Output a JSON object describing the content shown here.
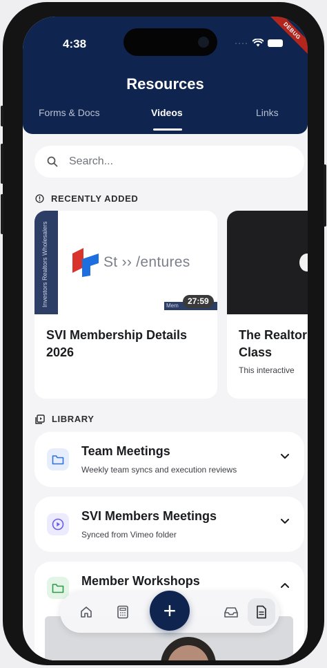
{
  "status_bar": {
    "time": "4:38",
    "debug_label": "DEBUG"
  },
  "header": {
    "title": "Resources",
    "tabs": [
      {
        "label": "Forms & Docs",
        "active": false
      },
      {
        "label": "Videos",
        "active": true
      },
      {
        "label": "Links",
        "active": false
      }
    ]
  },
  "search": {
    "placeholder": "Search..."
  },
  "recently_added": {
    "heading": "RECENTLY ADDED",
    "cards": [
      {
        "title": "SVI Membership Details 2026",
        "duration": "27:59",
        "thumb_band_text": "Investors Realtors Wholesalers",
        "thumb_logo_text": "St  ›› /entures",
        "thumb_mini_text": "Mem"
      },
      {
        "title": "The Realtor Class",
        "subtitle": "This interactive"
      }
    ]
  },
  "library": {
    "heading": "LIBRARY",
    "items": [
      {
        "title": "Team Meetings",
        "subtitle": "Weekly team syncs and execution reviews",
        "icon": "folder-icon",
        "expanded": false
      },
      {
        "title": "SVI Members Meetings",
        "subtitle": "Synced from Vimeo folder",
        "icon": "play-circle-icon",
        "expanded": false
      },
      {
        "title": "Member Workshops",
        "icon": "folder-icon",
        "expanded": true
      }
    ]
  },
  "bottom_nav": {
    "items": [
      "home-icon",
      "calculator-icon",
      "add-icon",
      "inbox-icon",
      "document-icon"
    ],
    "active": "document-icon"
  },
  "colors": {
    "primary": "#0f2550",
    "background": "#f4f4f6",
    "debug": "#b3261e"
  }
}
